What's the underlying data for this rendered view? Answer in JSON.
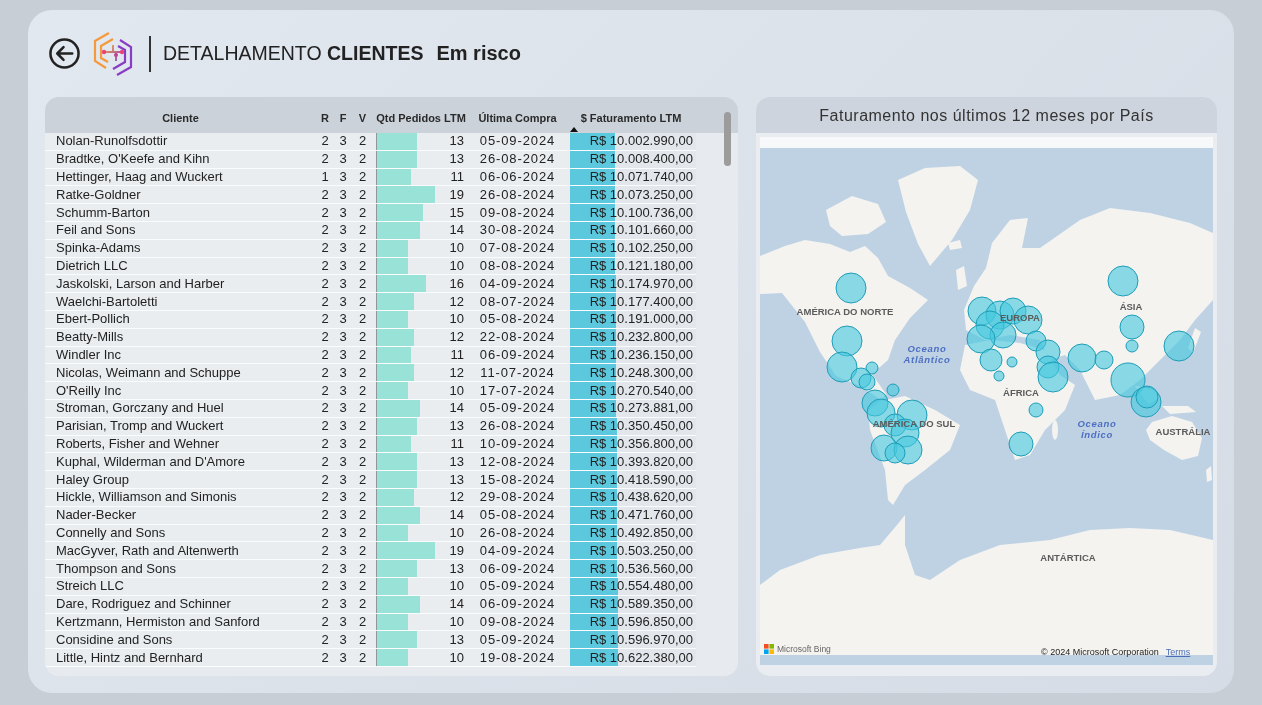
{
  "header": {
    "title": "DETALHAMENTO **CLIENTES**",
    "subtitle": "Em risco"
  },
  "table": {
    "columns": [
      {
        "label": "Cliente",
        "sorted": false
      },
      {
        "label": "R",
        "sorted": false
      },
      {
        "label": "F",
        "sorted": false
      },
      {
        "label": "V",
        "sorted": false
      },
      {
        "label": "Qtd Pedidos LTM",
        "sorted": false
      },
      {
        "label": "Última Compra",
        "sorted": false
      },
      {
        "label": "$ Faturamento LTM",
        "sorted": true
      }
    ],
    "rows": [
      {
        "cliente": "Nolan-Runolfsdottir",
        "r": "2",
        "f": "3",
        "v": "2",
        "qtd_pedidos": {
          "text": "13",
          "level": 0.433
        },
        "ultima_compra": "05-09-2024",
        "faturamento": {
          "text": "R$ 10.002.990,00",
          "level": 0.357
        }
      },
      {
        "cliente": "Bradtke, O'Keefe and Kihn",
        "r": "2",
        "f": "3",
        "v": "2",
        "qtd_pedidos": {
          "text": "13",
          "level": 0.433
        },
        "ultima_compra": "26-08-2024",
        "faturamento": {
          "text": "R$ 10.008.400,00",
          "level": 0.357
        }
      },
      {
        "cliente": "Hettinger, Haag and Wuckert",
        "r": "1",
        "f": "3",
        "v": "2",
        "qtd_pedidos": {
          "text": "11",
          "level": 0.367
        },
        "ultima_compra": "06-06-2024",
        "faturamento": {
          "text": "R$ 10.071.740,00",
          "level": 0.36
        }
      },
      {
        "cliente": "Ratke-Goldner",
        "r": "2",
        "f": "3",
        "v": "2",
        "qtd_pedidos": {
          "text": "19",
          "level": 0.633
        },
        "ultima_compra": "26-08-2024",
        "faturamento": {
          "text": "R$ 10.073.250,00",
          "level": 0.36
        }
      },
      {
        "cliente": "Schumm-Barton",
        "r": "2",
        "f": "3",
        "v": "2",
        "qtd_pedidos": {
          "text": "15",
          "level": 0.5
        },
        "ultima_compra": "09-08-2024",
        "faturamento": {
          "text": "R$ 10.100.736,00",
          "level": 0.361
        }
      },
      {
        "cliente": "Feil and Sons",
        "r": "2",
        "f": "3",
        "v": "2",
        "qtd_pedidos": {
          "text": "14",
          "level": 0.467
        },
        "ultima_compra": "30-08-2024",
        "faturamento": {
          "text": "R$ 10.101.660,00",
          "level": 0.361
        }
      },
      {
        "cliente": "Spinka-Adams",
        "r": "2",
        "f": "3",
        "v": "2",
        "qtd_pedidos": {
          "text": "10",
          "level": 0.333
        },
        "ultima_compra": "07-08-2024",
        "faturamento": {
          "text": "R$ 10.102.250,00",
          "level": 0.361
        }
      },
      {
        "cliente": "Dietrich LLC",
        "r": "2",
        "f": "3",
        "v": "2",
        "qtd_pedidos": {
          "text": "10",
          "level": 0.333
        },
        "ultima_compra": "08-08-2024",
        "faturamento": {
          "text": "R$ 10.121.180,00",
          "level": 0.361
        }
      },
      {
        "cliente": "Jaskolski, Larson and Harber",
        "r": "2",
        "f": "3",
        "v": "2",
        "qtd_pedidos": {
          "text": "16",
          "level": 0.533
        },
        "ultima_compra": "04-09-2024",
        "faturamento": {
          "text": "R$ 10.174.970,00",
          "level": 0.363
        }
      },
      {
        "cliente": "Waelchi-Bartoletti",
        "r": "2",
        "f": "3",
        "v": "2",
        "qtd_pedidos": {
          "text": "12",
          "level": 0.4
        },
        "ultima_compra": "08-07-2024",
        "faturamento": {
          "text": "R$ 10.177.400,00",
          "level": 0.363
        }
      },
      {
        "cliente": "Ebert-Pollich",
        "r": "2",
        "f": "3",
        "v": "2",
        "qtd_pedidos": {
          "text": "10",
          "level": 0.333
        },
        "ultima_compra": "05-08-2024",
        "faturamento": {
          "text": "R$ 10.191.000,00",
          "level": 0.364
        }
      },
      {
        "cliente": "Beatty-Mills",
        "r": "2",
        "f": "3",
        "v": "2",
        "qtd_pedidos": {
          "text": "12",
          "level": 0.4
        },
        "ultima_compra": "22-08-2024",
        "faturamento": {
          "text": "R$ 10.232.800,00",
          "level": 0.365
        }
      },
      {
        "cliente": "Windler Inc",
        "r": "2",
        "f": "3",
        "v": "2",
        "qtd_pedidos": {
          "text": "11",
          "level": 0.367
        },
        "ultima_compra": "06-09-2024",
        "faturamento": {
          "text": "R$ 10.236.150,00",
          "level": 0.366
        }
      },
      {
        "cliente": "Nicolas, Weimann and Schuppe",
        "r": "2",
        "f": "3",
        "v": "2",
        "qtd_pedidos": {
          "text": "12",
          "level": 0.4
        },
        "ultima_compra": "11-07-2024",
        "faturamento": {
          "text": "R$ 10.248.300,00",
          "level": 0.366
        }
      },
      {
        "cliente": "O'Reilly Inc",
        "r": "2",
        "f": "3",
        "v": "2",
        "qtd_pedidos": {
          "text": "10",
          "level": 0.333
        },
        "ultima_compra": "17-07-2024",
        "faturamento": {
          "text": "R$ 10.270.540,00",
          "level": 0.367
        }
      },
      {
        "cliente": "Stroman, Gorczany and Huel",
        "r": "2",
        "f": "3",
        "v": "2",
        "qtd_pedidos": {
          "text": "14",
          "level": 0.467
        },
        "ultima_compra": "05-09-2024",
        "faturamento": {
          "text": "R$ 10.273.881,00",
          "level": 0.367
        }
      },
      {
        "cliente": "Parisian, Tromp and Wuckert",
        "r": "2",
        "f": "3",
        "v": "2",
        "qtd_pedidos": {
          "text": "13",
          "level": 0.433
        },
        "ultima_compra": "26-08-2024",
        "faturamento": {
          "text": "R$ 10.350.450,00",
          "level": 0.37
        }
      },
      {
        "cliente": "Roberts, Fisher and Wehner",
        "r": "2",
        "f": "3",
        "v": "2",
        "qtd_pedidos": {
          "text": "11",
          "level": 0.367
        },
        "ultima_compra": "10-09-2024",
        "faturamento": {
          "text": "R$ 10.356.800,00",
          "level": 0.37
        }
      },
      {
        "cliente": "Kuphal, Wilderman and D'Amore",
        "r": "2",
        "f": "3",
        "v": "2",
        "qtd_pedidos": {
          "text": "13",
          "level": 0.433
        },
        "ultima_compra": "12-08-2024",
        "faturamento": {
          "text": "R$ 10.393.820,00",
          "level": 0.371
        }
      },
      {
        "cliente": "Haley Group",
        "r": "2",
        "f": "3",
        "v": "2",
        "qtd_pedidos": {
          "text": "13",
          "level": 0.433
        },
        "ultima_compra": "15-08-2024",
        "faturamento": {
          "text": "R$ 10.418.590,00",
          "level": 0.372
        }
      },
      {
        "cliente": "Hickle, Williamson and Simonis",
        "r": "2",
        "f": "3",
        "v": "2",
        "qtd_pedidos": {
          "text": "12",
          "level": 0.4
        },
        "ultima_compra": "29-08-2024",
        "faturamento": {
          "text": "R$ 10.438.620,00",
          "level": 0.373
        }
      },
      {
        "cliente": "Nader-Becker",
        "r": "2",
        "f": "3",
        "v": "2",
        "qtd_pedidos": {
          "text": "14",
          "level": 0.467
        },
        "ultima_compra": "05-08-2024",
        "faturamento": {
          "text": "R$ 10.471.760,00",
          "level": 0.374
        }
      },
      {
        "cliente": "Connelly and Sons",
        "r": "2",
        "f": "3",
        "v": "2",
        "qtd_pedidos": {
          "text": "10",
          "level": 0.333
        },
        "ultima_compra": "26-08-2024",
        "faturamento": {
          "text": "R$ 10.492.850,00",
          "level": 0.375
        }
      },
      {
        "cliente": "MacGyver, Rath and Altenwerth",
        "r": "2",
        "f": "3",
        "v": "2",
        "qtd_pedidos": {
          "text": "19",
          "level": 0.633
        },
        "ultima_compra": "04-09-2024",
        "faturamento": {
          "text": "R$ 10.503.250,00",
          "level": 0.375
        }
      },
      {
        "cliente": "Thompson and Sons",
        "r": "2",
        "f": "3",
        "v": "2",
        "qtd_pedidos": {
          "text": "13",
          "level": 0.433
        },
        "ultima_compra": "06-09-2024",
        "faturamento": {
          "text": "R$ 10.536.560,00",
          "level": 0.376
        }
      },
      {
        "cliente": "Streich LLC",
        "r": "2",
        "f": "3",
        "v": "2",
        "qtd_pedidos": {
          "text": "10",
          "level": 0.333
        },
        "ultima_compra": "05-09-2024",
        "faturamento": {
          "text": "R$ 10.554.480,00",
          "level": 0.377
        }
      },
      {
        "cliente": "Dare, Rodriguez and Schinner",
        "r": "2",
        "f": "3",
        "v": "2",
        "qtd_pedidos": {
          "text": "14",
          "level": 0.467
        },
        "ultima_compra": "06-09-2024",
        "faturamento": {
          "text": "R$ 10.589.350,00",
          "level": 0.378
        }
      },
      {
        "cliente": "Kertzmann, Hermiston and Sanford",
        "r": "2",
        "f": "3",
        "v": "2",
        "qtd_pedidos": {
          "text": "10",
          "level": 0.333
        },
        "ultima_compra": "09-08-2024",
        "faturamento": {
          "text": "R$ 10.596.850,00",
          "level": 0.378
        }
      },
      {
        "cliente": "Considine and Sons",
        "r": "2",
        "f": "3",
        "v": "2",
        "qtd_pedidos": {
          "text": "13",
          "level": 0.433
        },
        "ultima_compra": "05-09-2024",
        "faturamento": {
          "text": "R$ 10.596.970,00",
          "level": 0.378
        }
      },
      {
        "cliente": "Little, Hintz and Bernhard",
        "r": "2",
        "f": "3",
        "v": "2",
        "qtd_pedidos": {
          "text": "10",
          "level": 0.333
        },
        "ultima_compra": "19-08-2024",
        "faturamento": {
          "text": "R$ 10.622.380,00",
          "level": 0.379
        }
      }
    ]
  },
  "map": {
    "title": "Faturamento nos últimos 12 meses por País",
    "labels": [
      {
        "text": "AMÉRICA DO NORTE",
        "kind": "continent"
      },
      {
        "text": "EUROPA",
        "kind": "continent"
      },
      {
        "text": "ÁSIA",
        "kind": "continent"
      },
      {
        "text": "Oceano Atlântico",
        "kind": "ocean"
      },
      {
        "text": "ÁFRICA",
        "kind": "continent"
      },
      {
        "text": "AMÉRICA DO SUL",
        "kind": "continent"
      },
      {
        "text": "Oceano Índico",
        "kind": "ocean"
      },
      {
        "text": "AUSTRÁLIA",
        "kind": "continent"
      },
      {
        "text": "ANTÁRTICA",
        "kind": "continent"
      }
    ],
    "attribution": {
      "provider": "Microsoft Bing",
      "copyright": "© 2024 Microsoft Corporation",
      "terms": "Terms"
    }
  }
}
